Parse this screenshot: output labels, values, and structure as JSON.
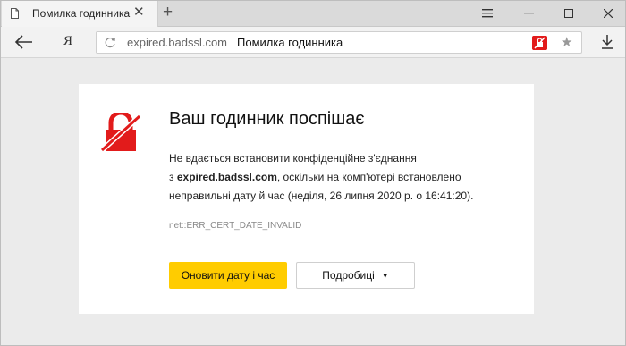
{
  "tab": {
    "title": "Помилка годинника",
    "close": "✕"
  },
  "new_tab": "+",
  "window_controls": {
    "menu": "≡",
    "minimize": "—",
    "maximize": "☐",
    "close": "✕"
  },
  "nav": {
    "logo": "Я"
  },
  "address": {
    "url": "expired.badssl.com",
    "page_title": "Помилка годинника",
    "star": "★"
  },
  "page": {
    "heading": "Ваш годинник поспішає",
    "line1": "Не вдається встановити конфіденційне з'єднання",
    "line2_prefix": "з ",
    "domain": "expired.badssl.com",
    "line2_suffix": ", оскільки на комп'ютері встановлено",
    "line3": "неправильні дату й час (неділя, 26 липня 2020 р. о 16:41:20).",
    "error_code": "net::ERR_CERT_DATE_INVALID",
    "update_button": "Оновити дату і час",
    "details_button": "Подробиці",
    "details_caret": "▼"
  },
  "colors": {
    "accent": "#ffcc00",
    "alert": "#e21b1b"
  }
}
